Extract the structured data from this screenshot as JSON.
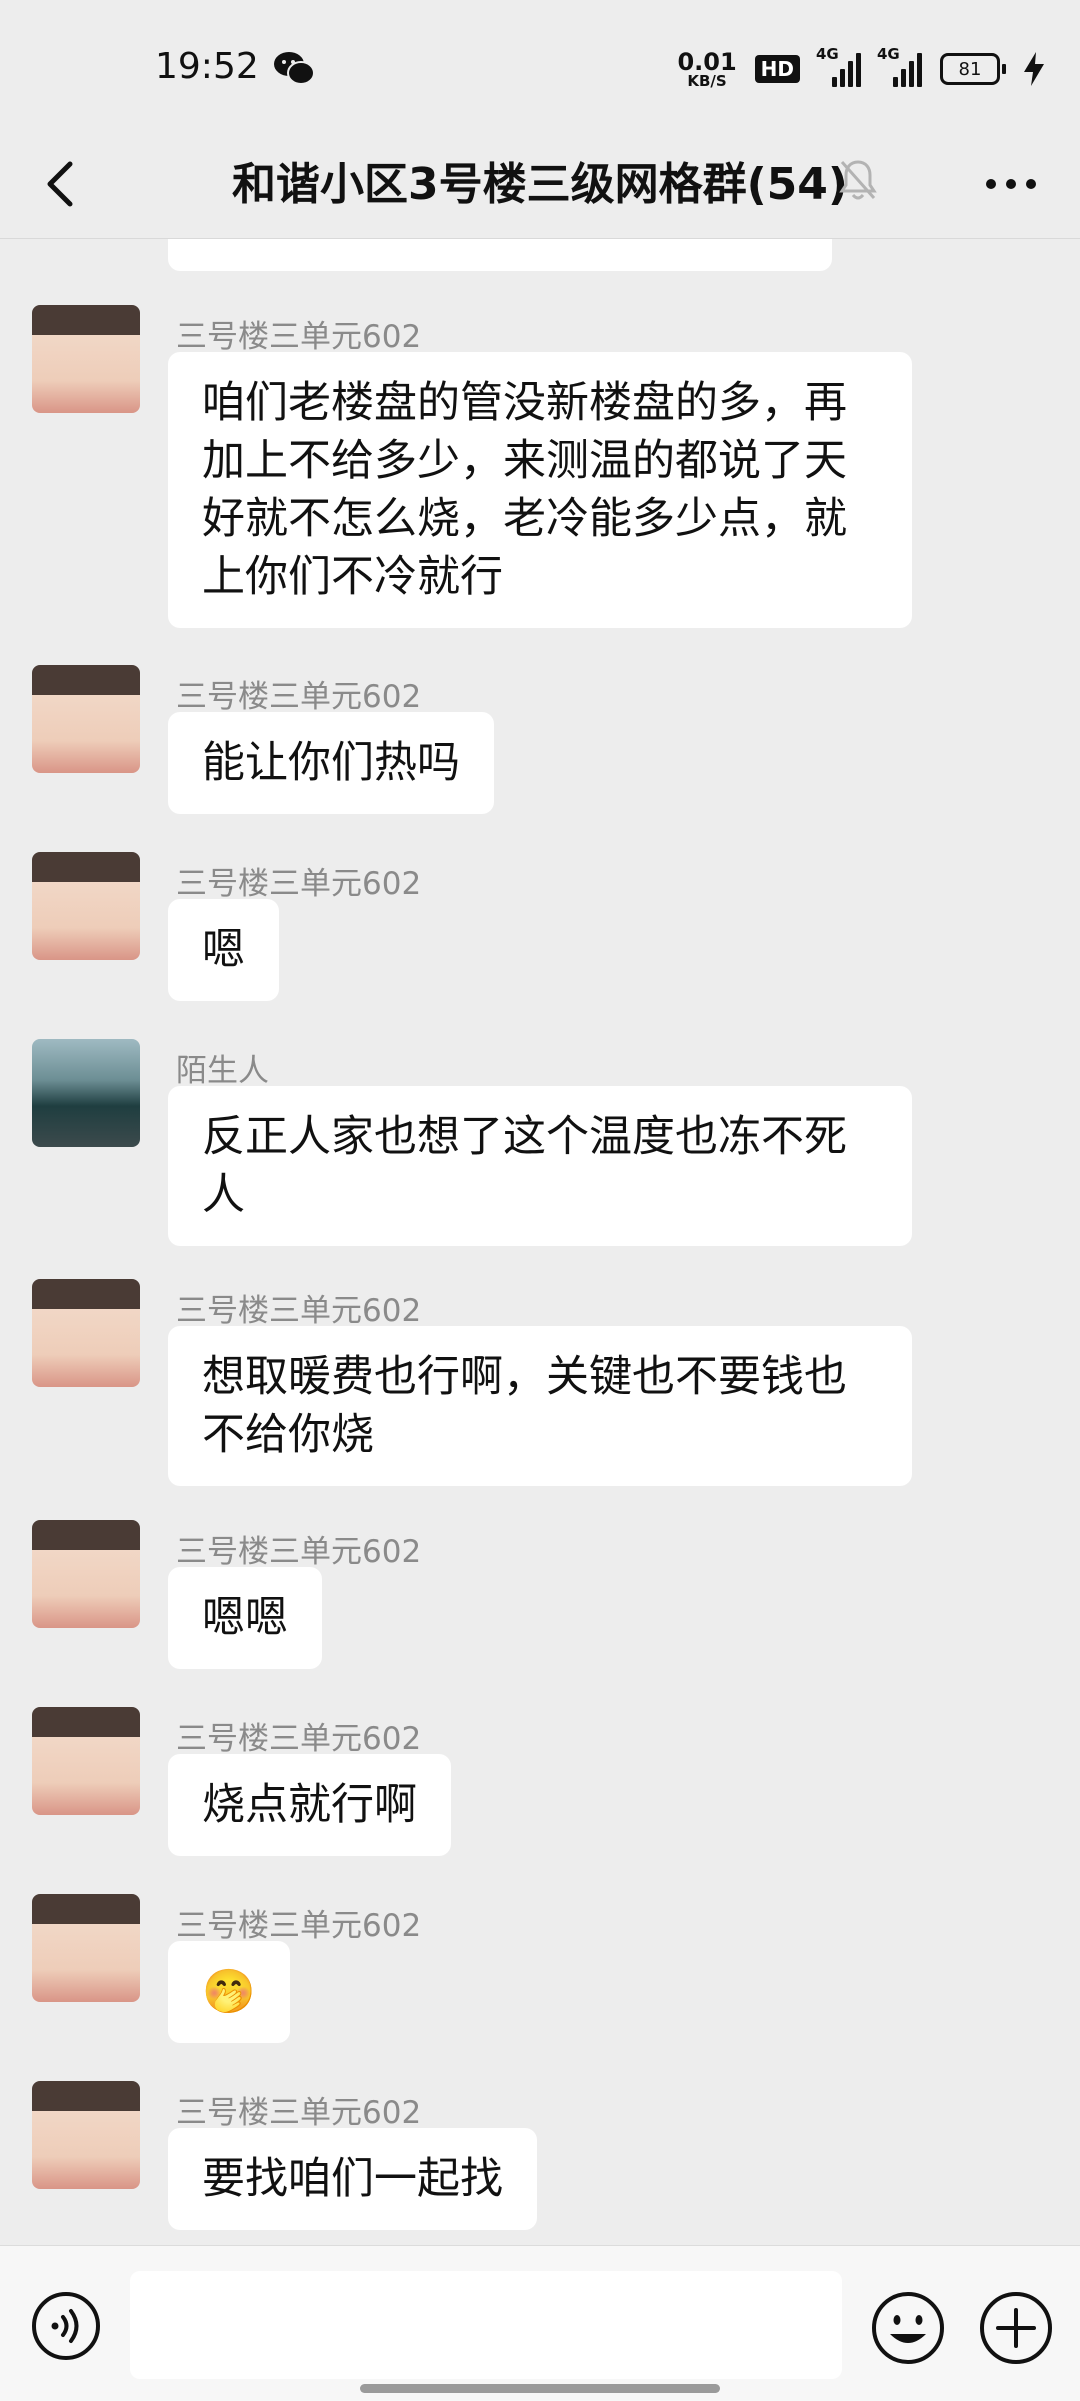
{
  "status_bar": {
    "time": "19:52",
    "net_speed_value": "0.01",
    "net_speed_unit": "KB/S",
    "hd_badge": "HD",
    "sim1_label": "4G",
    "sim2_label": "4G",
    "battery_level": "81",
    "icons": [
      "wechat-icon",
      "hd-voice-icon",
      "signal-icon",
      "signal-icon",
      "battery-icon",
      "charging-icon"
    ]
  },
  "header": {
    "title": "和谐小区3号楼三级网格群(54)",
    "icons": [
      "back-icon",
      "mute-icon",
      "more-icon"
    ]
  },
  "messages": [
    {
      "sender": "三号楼三单元602",
      "text": "咱们老楼盘的管没新楼盘的多，再加上不给多少，来测温的都说了天好就不怎么烧，老冷能多少点，就上你们不冷就行"
    },
    {
      "sender": "三号楼三单元602",
      "text": "能让你们热吗"
    },
    {
      "sender": "三号楼三单元602",
      "text": "嗯"
    },
    {
      "sender": "陌生人",
      "text": "反正人家也想了这个温度也冻不死人"
    },
    {
      "sender": "三号楼三单元602",
      "text": "想取暖费也行啊，关键也不要钱也不给你烧"
    },
    {
      "sender": "三号楼三单元602",
      "text": "嗯嗯"
    },
    {
      "sender": "三号楼三单元602",
      "text": "烧点就行啊"
    },
    {
      "sender": "三号楼三单元602",
      "text": "🤭"
    },
    {
      "sender": "三号楼三单元602",
      "text": "要找咱们一起找"
    }
  ],
  "input_bar": {
    "placeholder": "",
    "icons": [
      "voice-icon",
      "emoji-icon",
      "plus-icon"
    ]
  },
  "colors": {
    "background": "#ededed",
    "bubble": "#ffffff",
    "sender_name": "#8a8a8a"
  }
}
